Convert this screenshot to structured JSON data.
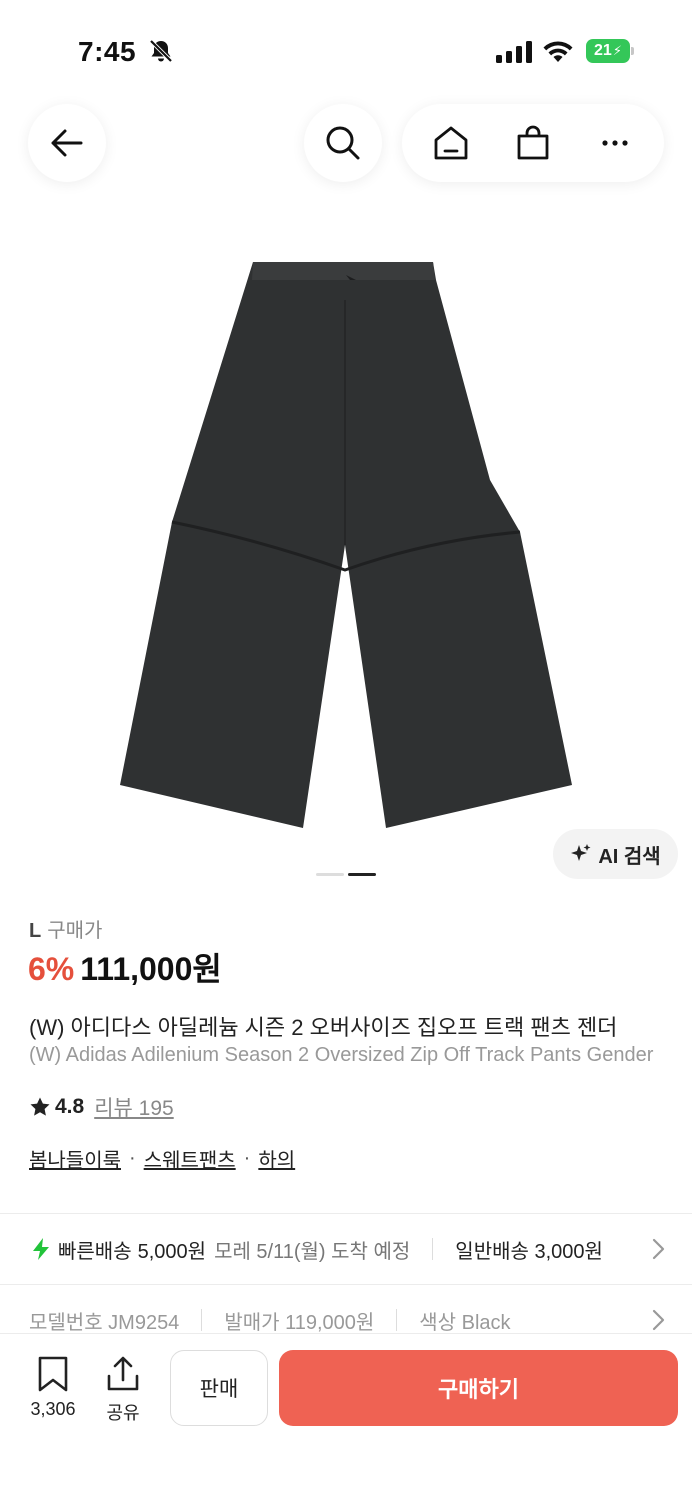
{
  "status": {
    "time": "7:45",
    "battery": "21"
  },
  "nav": {
    "back": "back-icon",
    "search": "search-icon",
    "home": "home-icon",
    "bag": "shopping-bag-icon",
    "more": "more-icon"
  },
  "gallery": {
    "ai_label": "AI 검색",
    "total": 2,
    "current": 2
  },
  "product": {
    "size": "L",
    "buy_label": "구매가",
    "discount": "6%",
    "price": "111,000원",
    "title_ko": "(W) 아디다스 아딜레늄 시즌 2 오버사이즈 집오프 트랙 팬츠 젠더",
    "title_en": "(W) Adidas Adilenium Season 2 Oversized Zip Off Track Pants Gender",
    "rating": "4.8",
    "reviews": "리뷰 195",
    "tags": [
      "봄나들이룩",
      "스웨트팬츠",
      "하의"
    ]
  },
  "delivery": {
    "fast_label": "빠른배송",
    "fast_price": "5,000원",
    "arrival": "모레 5/11(월) 도착 예정",
    "normal": "일반배송 3,000원"
  },
  "specs": {
    "model": "모델번호 JM9254",
    "release_price": "발매가 119,000원",
    "color": "색상 Black"
  },
  "bottom": {
    "bookmark_count": "3,306",
    "share_label": "공유",
    "sell_label": "판매",
    "buy_label": "구매하기"
  },
  "colors": {
    "accent": "#ef6253",
    "discount": "#e5503c",
    "bolt": "#22c33a"
  }
}
